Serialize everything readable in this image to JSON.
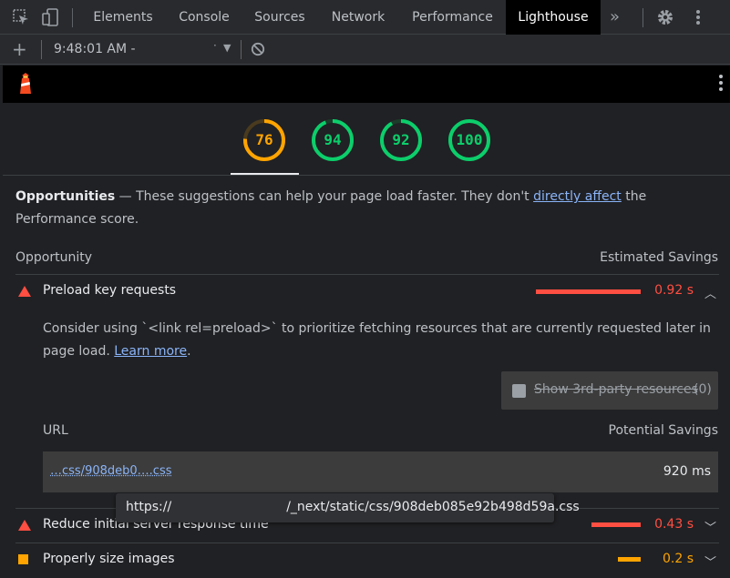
{
  "devtools": {
    "tabs": [
      "Elements",
      "Console",
      "Sources",
      "Network",
      "Performance",
      "Lighthouse"
    ],
    "active_tab": "Lighthouse",
    "more_tabs_glyph": "»"
  },
  "toolbar": {
    "timestamp": "9:48:01 AM -"
  },
  "lighthouse": {
    "gauges": [
      {
        "score": "76",
        "value": 0.76,
        "color": "#ffa400",
        "track": "#4a3a1e"
      },
      {
        "score": "94",
        "value": 0.94,
        "color": "#0cce6b",
        "track": "#1b3d2a"
      },
      {
        "score": "92",
        "value": 0.92,
        "color": "#0cce6b",
        "track": "#1b3d2a"
      },
      {
        "score": "100",
        "value": 1.0,
        "color": "#0cce6b",
        "track": "#1b3d2a"
      }
    ],
    "opportunities": {
      "heading": "Opportunities",
      "intro_before": " — These suggestions can help your page load faster. They don't ",
      "intro_link": "directly affect",
      "intro_after": " the Performance score.",
      "col_opportunity": "Opportunity",
      "col_savings": "Estimated Savings",
      "audits": [
        {
          "title": "Preload key requests",
          "savings": "0.92 s",
          "bar_fraction": 1.0,
          "color": "#ff4e42",
          "expanded": true
        },
        {
          "title": "Reduce initial server response time",
          "savings": "0.43 s",
          "bar_fraction": 0.47,
          "color": "#ff4e42",
          "expanded": false
        },
        {
          "title": "Properly size images",
          "savings": "0.2 s",
          "bar_fraction": 0.22,
          "color": "#ffa400",
          "expanded": false
        }
      ],
      "detail": {
        "desc_before": "Consider using `<link rel=preload>` to prioritize fetching resources that are currently requested later in page load. ",
        "learn_more": "Learn more",
        "desc_after": ".",
        "third_party_label": "Show 3rd-party resources",
        "third_party_count": "(0)",
        "url_header": "URL",
        "savings_header": "Potential Savings",
        "rows": [
          {
            "url": "…css/908deb0….css",
            "savings": "920 ms"
          }
        ],
        "tooltip_prefix": "https://",
        "tooltip_suffix": "/_next/static/css/908deb085e92b498d59a.css"
      }
    }
  },
  "icons": {
    "inspect": "inspect-icon",
    "device": "device-toggle-icon",
    "settings": "gear-icon",
    "menu": "kebab-menu-icon",
    "add": "plus-icon",
    "clear": "clear-icon",
    "lighthouse_logo": "lighthouse-logo-icon"
  }
}
